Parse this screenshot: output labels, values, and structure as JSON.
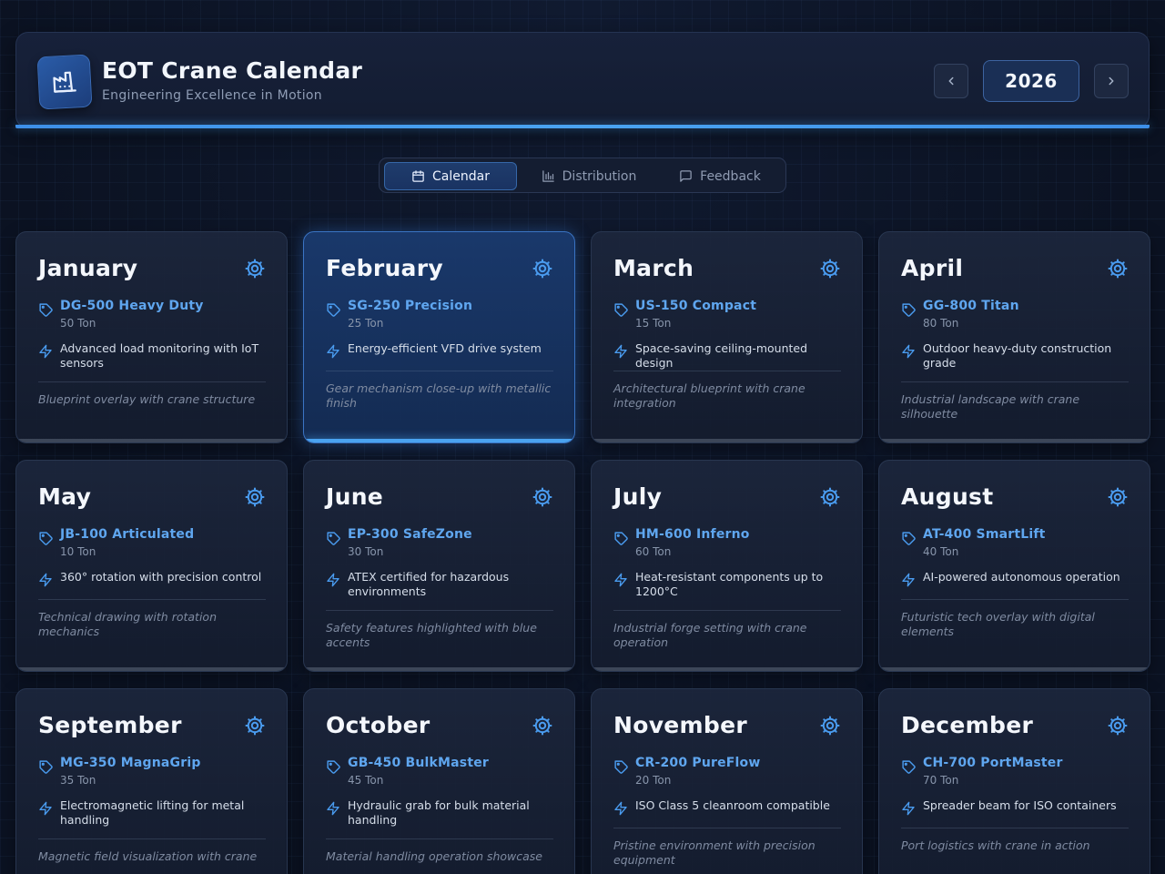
{
  "header": {
    "title": "EOT Crane Calendar",
    "subtitle": "Engineering Excellence in Motion",
    "year": "2026",
    "prev_icon": "chevron-left-icon",
    "next_icon": "chevron-right-icon",
    "logo_icon": "factory-icon"
  },
  "tabs": [
    {
      "label": "Calendar",
      "icon": "calendar-icon",
      "active": true
    },
    {
      "label": "Distribution",
      "icon": "bar-chart-icon",
      "active": false
    },
    {
      "label": "Feedback",
      "icon": "message-icon",
      "active": false
    }
  ],
  "colors": {
    "accent": "#4aa3f0",
    "model_text": "#5fa6ef",
    "background": "#0c1424",
    "card_active": "#1a3a6e"
  },
  "months": [
    {
      "month": "January",
      "model": "DG-500 Heavy Duty",
      "capacity": "50 Ton",
      "feature": "Advanced load monitoring with IoT sensors",
      "visual": "Blueprint overlay with crane structure"
    },
    {
      "month": "February",
      "model": "SG-250 Precision",
      "capacity": "25 Ton",
      "feature": "Energy-efficient VFD drive system",
      "visual": "Gear mechanism close-up with metallic finish"
    },
    {
      "month": "March",
      "model": "US-150 Compact",
      "capacity": "15 Ton",
      "feature": "Space-saving ceiling-mounted design",
      "visual": "Architectural blueprint with crane integration"
    },
    {
      "month": "April",
      "model": "GG-800 Titan",
      "capacity": "80 Ton",
      "feature": "Outdoor heavy-duty construction grade",
      "visual": "Industrial landscape with crane silhouette"
    },
    {
      "month": "May",
      "model": "JB-100 Articulated",
      "capacity": "10 Ton",
      "feature": "360° rotation with precision control",
      "visual": "Technical drawing with rotation mechanics"
    },
    {
      "month": "June",
      "model": "EP-300 SafeZone",
      "capacity": "30 Ton",
      "feature": "ATEX certified for hazardous environments",
      "visual": "Safety features highlighted with blue accents"
    },
    {
      "month": "July",
      "model": "HM-600 Inferno",
      "capacity": "60 Ton",
      "feature": "Heat-resistant components up to 1200°C",
      "visual": "Industrial forge setting with crane operation"
    },
    {
      "month": "August",
      "model": "AT-400 SmartLift",
      "capacity": "40 Ton",
      "feature": "AI-powered autonomous operation",
      "visual": "Futuristic tech overlay with digital elements"
    },
    {
      "month": "September",
      "model": "MG-350 MagnaGrip",
      "capacity": "35 Ton",
      "feature": "Electromagnetic lifting for metal handling",
      "visual": "Magnetic field visualization with crane"
    },
    {
      "month": "October",
      "model": "GB-450 BulkMaster",
      "capacity": "45 Ton",
      "feature": "Hydraulic grab for bulk material handling",
      "visual": "Material handling operation showcase"
    },
    {
      "month": "November",
      "model": "CR-200 PureFlow",
      "capacity": "20 Ton",
      "feature": "ISO Class 5 cleanroom compatible",
      "visual": "Pristine environment with precision equipment"
    },
    {
      "month": "December",
      "model": "CH-700 PortMaster",
      "capacity": "70 Ton",
      "feature": "Spreader beam for ISO containers",
      "visual": "Port logistics with crane in action"
    }
  ]
}
